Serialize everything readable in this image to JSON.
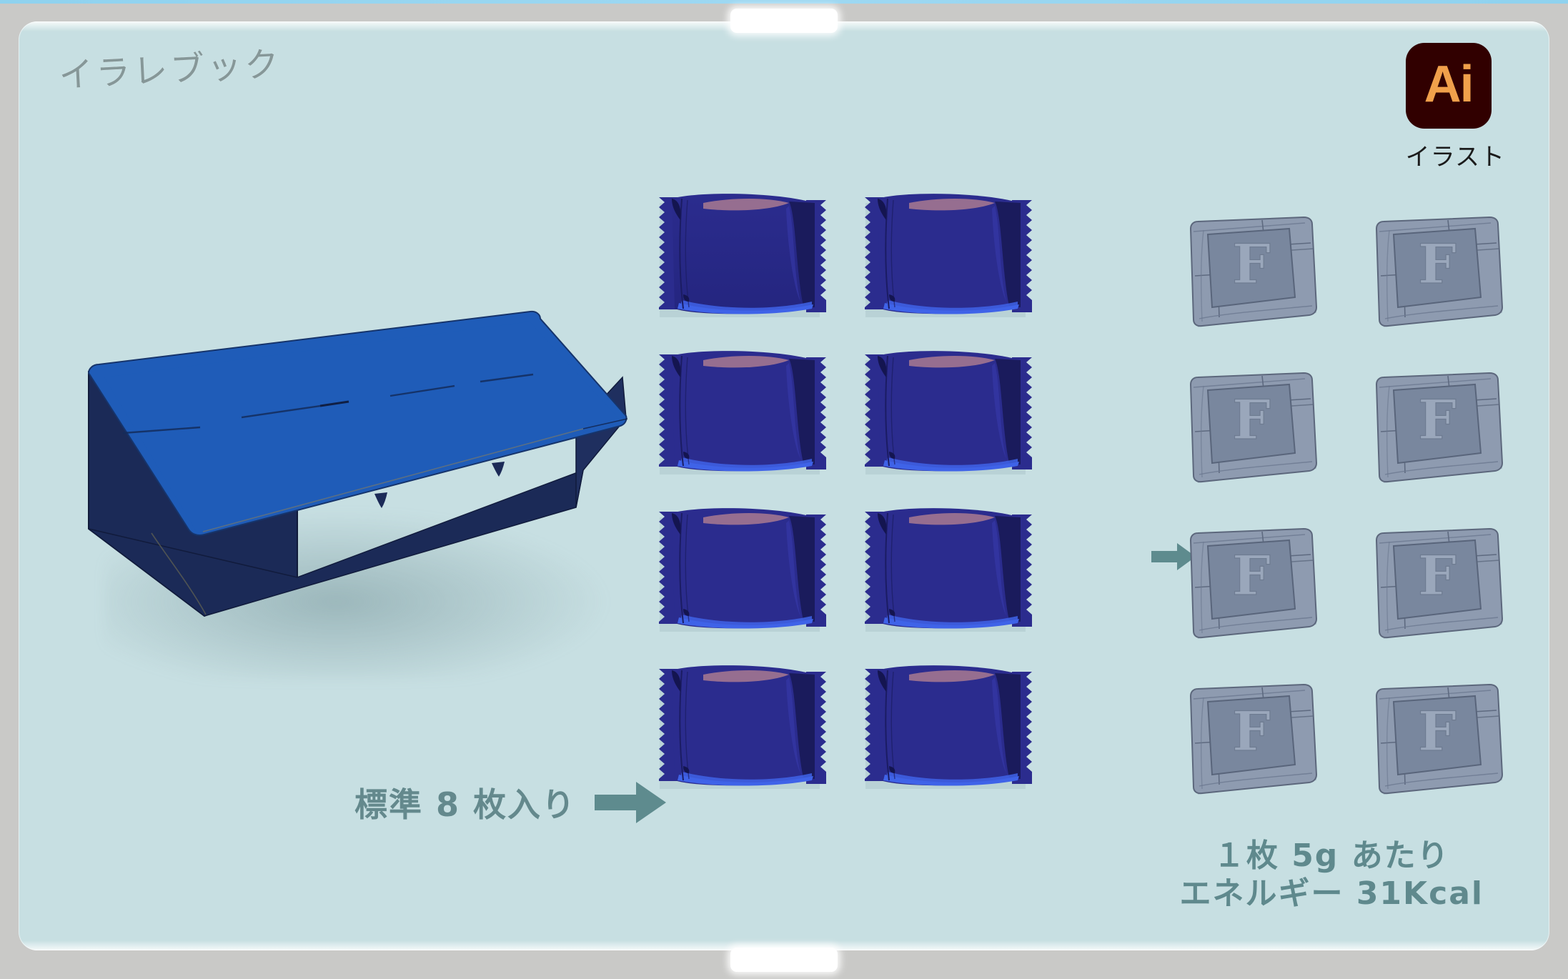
{
  "frame": {
    "notch_top_name": "camera-notch",
    "notch_bottom_name": "home-notch"
  },
  "header": {
    "brand_title": "イラレブック"
  },
  "app_badge": {
    "logo_text": "Ai",
    "caption": "イラスト",
    "badge_bg": "#310000",
    "logo_color": "#f0a04b"
  },
  "product": {
    "box_label": "",
    "box_top_color": "#1f5cb8",
    "box_side_color": "#1b2a57",
    "pack_count_text": "標準 8 枚入り",
    "arrow_color": "#5e8b8e"
  },
  "wrappers": {
    "count": 8,
    "body_color": "#2b2c8e",
    "highlight_color": "#3f63e8",
    "top_accent_color": "#9c7290",
    "items": [
      {
        "id": 1,
        "label": ""
      },
      {
        "id": 2,
        "label": ""
      },
      {
        "id": 3,
        "label": ""
      },
      {
        "id": 4,
        "label": ""
      },
      {
        "id": 5,
        "label": ""
      },
      {
        "id": 6,
        "label": ""
      },
      {
        "id": 7,
        "label": ""
      },
      {
        "id": 8,
        "label": ""
      }
    ]
  },
  "crackers": {
    "count": 8,
    "body_color": "#8e9bb0",
    "inset_color": "#79879e",
    "letter": "F",
    "items": [
      {
        "id": 1,
        "letter": "F"
      },
      {
        "id": 2,
        "letter": "F"
      },
      {
        "id": 3,
        "letter": "F"
      },
      {
        "id": 4,
        "letter": "F"
      },
      {
        "id": 5,
        "letter": "F"
      },
      {
        "id": 6,
        "letter": "F"
      },
      {
        "id": 7,
        "letter": "F"
      },
      {
        "id": 8,
        "letter": "F"
      }
    ]
  },
  "nutrition": {
    "line1": "１枚 5g あたり",
    "line2": "エネルギー  31Kcal",
    "text_color": "#5f898d"
  },
  "background": {
    "screen_color": "#c7dfe2",
    "bezel_color": "#c9c9c7"
  }
}
